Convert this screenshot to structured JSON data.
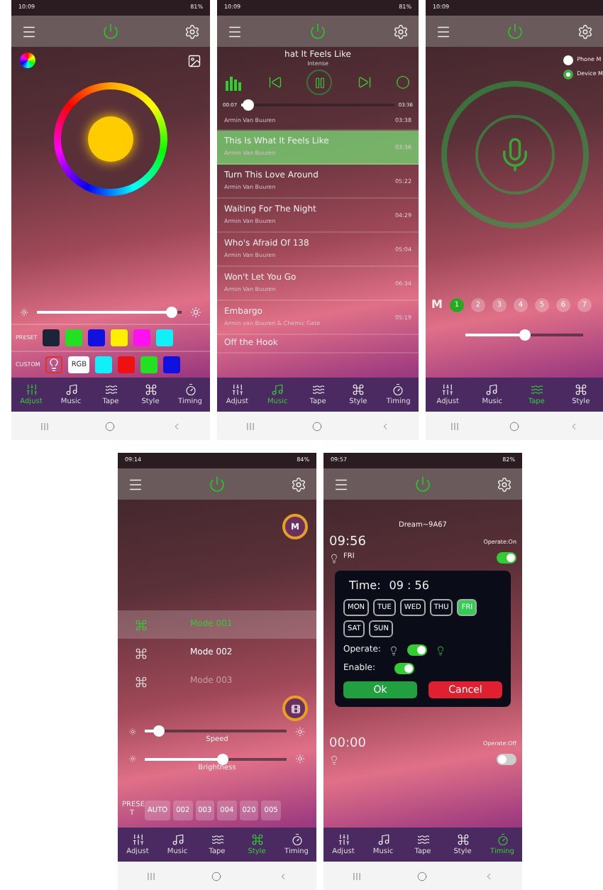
{
  "phones": [
    {
      "kind": "color",
      "status": {
        "time": "10:09",
        "battery": "81%"
      },
      "brightness": {
        "level": 0.93
      },
      "swatch_rows": [
        {
          "label": "PRESET",
          "swatches": [
            {
              "color": "#1c2438"
            },
            {
              "color": "#22e022"
            },
            {
              "color": "#1010e0"
            },
            {
              "color": "#ffee00"
            },
            {
              "color": "#ff10f0"
            },
            {
              "color": "#10f0f8"
            }
          ]
        },
        {
          "label": "CUSTOM",
          "rgb": "RGB",
          "swatches": [
            {
              "color": "#10f0f8"
            },
            {
              "color": "#ee1111"
            },
            {
              "color": "#22e022"
            },
            {
              "color": "#1010e0"
            }
          ]
        }
      ],
      "tabs": [
        {
          "label": "Adjust",
          "selected": true
        },
        {
          "label": "Music",
          "selected": false
        },
        {
          "label": "Tape",
          "selected": false
        },
        {
          "label": "Style",
          "selected": false
        },
        {
          "label": "Timing",
          "selected": false
        }
      ]
    },
    {
      "kind": "music",
      "status": {
        "time": "10:09",
        "battery": "81%"
      },
      "now_playing": {
        "title": "hat It Feels Like",
        "artist": "Intense"
      },
      "progress": {
        "level": 0.05,
        "elapsed": "00:07",
        "total": "03:36"
      },
      "songs": [
        {
          "artist": "Armin Van Buuren",
          "duration": "03:38",
          "selected": false
        },
        {
          "title": "This Is What It Feels Like",
          "artist": "Armin Van Buuren",
          "duration": "03:36",
          "selected": true
        },
        {
          "title": "Turn This Love Around",
          "artist": "Armin Van Buuren",
          "duration": "05:22",
          "selected": false
        },
        {
          "title": "Waiting For The Night",
          "artist": "Armin Van Buuren",
          "duration": "04:29",
          "selected": false
        },
        {
          "title": "Who's Afraid Of 138",
          "artist": "Armin Van Buuren",
          "duration": "05:04",
          "selected": false
        },
        {
          "title": "Won't Let You Go",
          "artist": "Armin Van Buuren",
          "duration": "06:34",
          "selected": false
        },
        {
          "title": "Embargo",
          "artist": "Armin van Buuren & Chemic Gate",
          "duration": "05:19",
          "selected": false
        },
        {
          "title": "Off the Hook",
          "selected": false
        }
      ],
      "tabs": [
        {
          "label": "Adjust",
          "selected": false
        },
        {
          "label": "Music",
          "selected": true
        },
        {
          "label": "Tape",
          "selected": false
        },
        {
          "label": "Style",
          "selected": false
        },
        {
          "label": "Timing",
          "selected": false
        }
      ]
    },
    {
      "kind": "mic",
      "status": {
        "time": "10:09"
      },
      "sources": [
        {
          "label": "Phone M",
          "selected": false
        },
        {
          "label": "Device M",
          "selected": true
        }
      ],
      "mode_label": "M",
      "modes": [
        {
          "label": "1",
          "selected": true
        },
        {
          "label": "2",
          "selected": false
        },
        {
          "label": "3",
          "selected": false
        },
        {
          "label": "4",
          "selected": false
        },
        {
          "label": "5",
          "selected": false
        },
        {
          "label": "6",
          "selected": false
        },
        {
          "label": "7",
          "selected": false
        }
      ],
      "sensitivity": {
        "level": 0.5
      },
      "tabs": [
        {
          "label": "Adjust",
          "selected": false
        },
        {
          "label": "Music",
          "selected": false
        },
        {
          "label": "Tape",
          "selected": true
        },
        {
          "label": "Style",
          "selected": false
        }
      ]
    },
    {
      "kind": "style",
      "status": {
        "time": "09:14",
        "battery": "84%"
      },
      "badge": "M",
      "modes": [
        {
          "label": "Mode 001",
          "selected": true,
          "disabled": false
        },
        {
          "label": "Mode 002",
          "selected": false,
          "disabled": false
        },
        {
          "label": "Mode 003",
          "selected": false,
          "disabled": true
        }
      ],
      "speed": {
        "label": "Speed",
        "level": 0.1
      },
      "brightness": {
        "label": "Brightness",
        "level": 0.55
      },
      "preset_label": "PRESE T",
      "presets": [
        {
          "label": "AUTO"
        },
        {
          "label": "002"
        },
        {
          "label": "003"
        },
        {
          "label": "004"
        },
        {
          "label": "020"
        },
        {
          "label": "005"
        }
      ],
      "tabs": [
        {
          "label": "Adjust",
          "selected": false
        },
        {
          "label": "Music",
          "selected": false
        },
        {
          "label": "Tape",
          "selected": false
        },
        {
          "label": "Style",
          "selected": true
        },
        {
          "label": "Timing",
          "selected": false
        }
      ]
    },
    {
      "kind": "timing",
      "status": {
        "time": "09:57",
        "battery": "82%"
      },
      "device": "Dream~9A67",
      "timers": [
        {
          "time": "09:56",
          "operate": "Operate:On",
          "days": "FRI",
          "on": true
        },
        {
          "time": "00:00",
          "operate": "Operate:Off",
          "on": false
        }
      ],
      "dialog": {
        "time_label": "Time:",
        "time": "09 : 56",
        "days": [
          {
            "label": "MON",
            "selected": false
          },
          {
            "label": "TUE",
            "selected": false
          },
          {
            "label": "WED",
            "selected": false
          },
          {
            "label": "THU",
            "selected": false
          },
          {
            "label": "FRI",
            "selected": true
          },
          {
            "label": "SAT",
            "selected": false
          },
          {
            "label": "SUN",
            "selected": false
          }
        ],
        "operate_label": "Operate:",
        "operate_on": true,
        "enable_label": "Enable:",
        "enabled": true,
        "ok": "Ok",
        "cancel": "Cancel"
      },
      "tabs": [
        {
          "label": "Adjust",
          "selected": false
        },
        {
          "label": "Music",
          "selected": false
        },
        {
          "label": "Tape",
          "selected": false
        },
        {
          "label": "Style",
          "selected": false
        },
        {
          "label": "Timing",
          "selected": true
        }
      ]
    }
  ]
}
